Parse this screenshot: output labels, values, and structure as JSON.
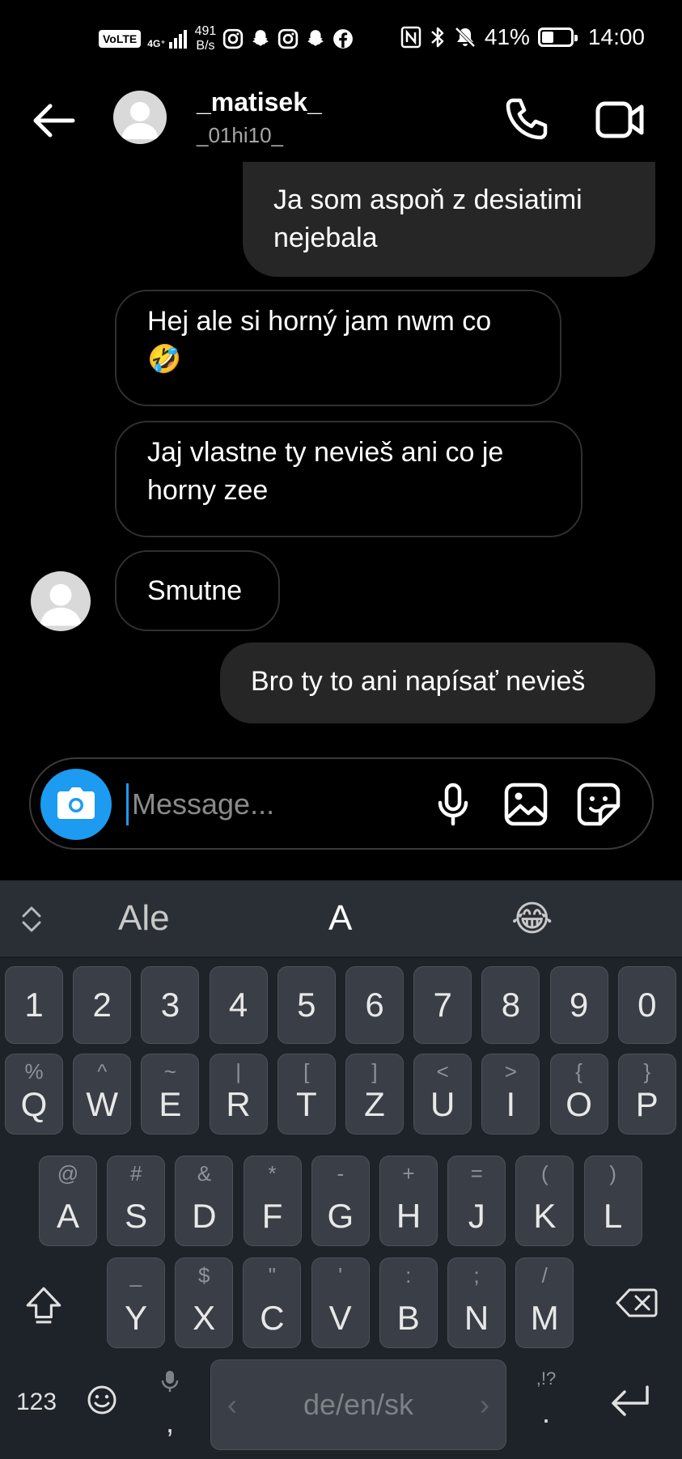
{
  "status_bar": {
    "volte": "VoLTE",
    "network": "4G⁺",
    "speed_value": "491",
    "speed_unit": "B/s",
    "battery": "41%",
    "battery_level": 0.41,
    "time": "14:00",
    "icons": [
      "instagram-icon",
      "snapchat-icon",
      "instagram-icon",
      "snapchat-icon",
      "facebook-icon",
      "nfc-icon",
      "bluetooth-icon",
      "mute-icon"
    ]
  },
  "header": {
    "name": "_matisek_",
    "username": "_01hi10_"
  },
  "messages": [
    {
      "side": "out",
      "text": "Ja som aspoň z desiatimi\nnejebala"
    },
    {
      "side": "in",
      "text": "Hej ale si horný jam nwm co\n🤣"
    },
    {
      "side": "in",
      "text": "Jaj vlastne ty nevieš ani co je\nhorny zee"
    },
    {
      "side": "in",
      "text": "Smutne"
    },
    {
      "side": "out",
      "text": "Bro ty to ani napísať nevieš"
    }
  ],
  "composer": {
    "placeholder": "Message..."
  },
  "keyboard": {
    "suggestions": [
      "Ale",
      "A",
      "😂"
    ],
    "number_row": [
      "1",
      "2",
      "3",
      "4",
      "5",
      "6",
      "7",
      "8",
      "9",
      "0"
    ],
    "row1": [
      {
        "main": "Q",
        "sec": "%"
      },
      {
        "main": "W",
        "sec": "^"
      },
      {
        "main": "E",
        "sec": "~"
      },
      {
        "main": "R",
        "sec": "|"
      },
      {
        "main": "T",
        "sec": "["
      },
      {
        "main": "Z",
        "sec": "]"
      },
      {
        "main": "U",
        "sec": "<"
      },
      {
        "main": "I",
        "sec": ">"
      },
      {
        "main": "O",
        "sec": "{"
      },
      {
        "main": "P",
        "sec": "}"
      }
    ],
    "row2": [
      {
        "main": "A",
        "sec": "@"
      },
      {
        "main": "S",
        "sec": "#"
      },
      {
        "main": "D",
        "sec": "&"
      },
      {
        "main": "F",
        "sec": "*"
      },
      {
        "main": "G",
        "sec": "-"
      },
      {
        "main": "H",
        "sec": "+"
      },
      {
        "main": "J",
        "sec": "="
      },
      {
        "main": "K",
        "sec": "("
      },
      {
        "main": "L",
        "sec": ")"
      }
    ],
    "row3": [
      {
        "main": "Y",
        "sec": "_"
      },
      {
        "main": "X",
        "sec": "$"
      },
      {
        "main": "C",
        "sec": "\""
      },
      {
        "main": "V",
        "sec": "'"
      },
      {
        "main": "B",
        "sec": ":"
      },
      {
        "main": "N",
        "sec": ";"
      },
      {
        "main": "M",
        "sec": "/"
      }
    ],
    "numbers_key": "123",
    "comma": ",",
    "space_label": "de/en/sk",
    "punct_hint": ",!?",
    "period": "."
  }
}
